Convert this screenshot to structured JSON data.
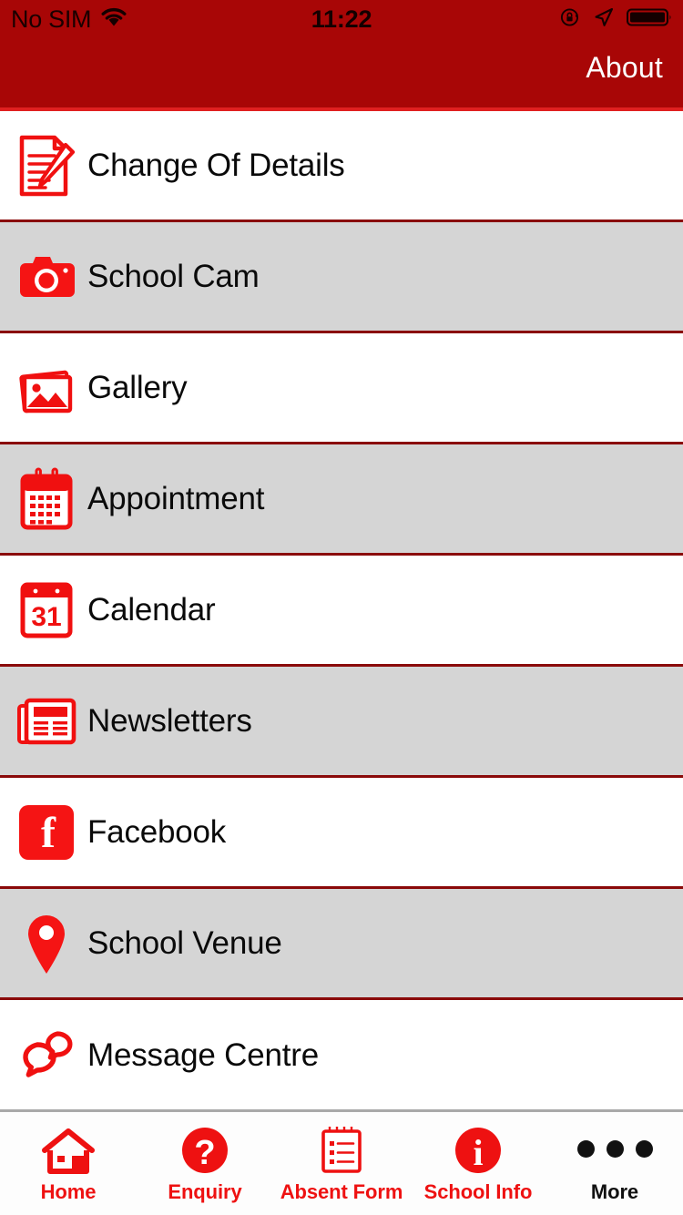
{
  "statusbar": {
    "carrier": "No SIM",
    "wifi_icon": "wifi-icon",
    "time": "11:22",
    "rotation_lock_icon": "rotation-lock-icon",
    "location_icon": "location-arrow-icon",
    "battery_icon": "battery-full-icon"
  },
  "header": {
    "about_label": "About",
    "background_color": "#A80606",
    "accent_color": "#E02020"
  },
  "colors": {
    "brand_red": "#EE1111",
    "header_red": "#A80606",
    "separator_red": "#8A0A0A",
    "alt_row_gray": "#D5D5D5",
    "text_black": "#0a0a0a"
  },
  "list": {
    "items": [
      {
        "label": "Change Of Details",
        "icon": "document-pencil-icon",
        "shaded": false
      },
      {
        "label": "School Cam",
        "icon": "camera-icon",
        "shaded": true
      },
      {
        "label": "Gallery",
        "icon": "photos-stack-icon",
        "shaded": false
      },
      {
        "label": "Appointment",
        "icon": "calendar-grid-icon",
        "shaded": true
      },
      {
        "label": "Calendar",
        "icon": "calendar-31-icon",
        "shaded": false
      },
      {
        "label": "Newsletters",
        "icon": "newspaper-icon",
        "shaded": true
      },
      {
        "label": "Facebook",
        "icon": "facebook-icon",
        "shaded": false
      },
      {
        "label": "School Venue",
        "icon": "map-pin-icon",
        "shaded": true
      },
      {
        "label": "Message Centre",
        "icon": "chat-bubbles-icon",
        "shaded": false
      }
    ]
  },
  "calendar_icon": {
    "day_number": "31"
  },
  "facebook_icon": {
    "glyph": "f"
  },
  "enquiry_icon": {
    "glyph": "?"
  },
  "school_info_icon": {
    "glyph": "i"
  },
  "tabbar": {
    "items": [
      {
        "label": "Home",
        "icon": "house-icon",
        "active_color": "red"
      },
      {
        "label": "Enquiry",
        "icon": "question-circle-icon",
        "active_color": "red"
      },
      {
        "label": "Absent Form",
        "icon": "notepad-list-icon",
        "active_color": "red"
      },
      {
        "label": "School Info",
        "icon": "info-circle-icon",
        "active_color": "red"
      },
      {
        "label": "More",
        "icon": "ellipsis-icon",
        "active_color": "black"
      }
    ]
  }
}
